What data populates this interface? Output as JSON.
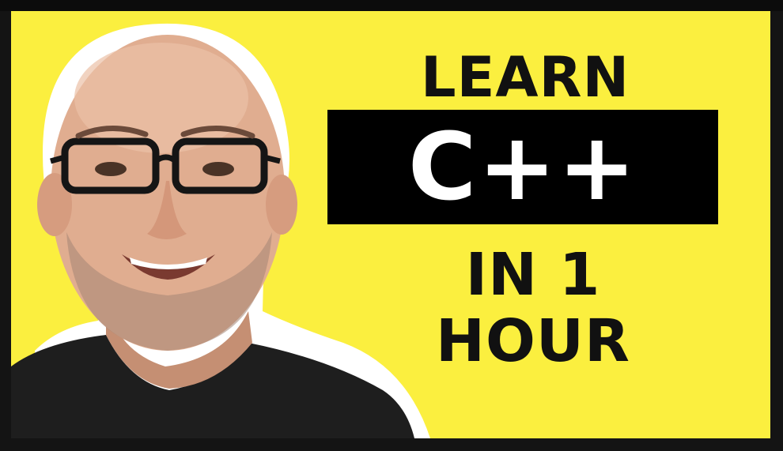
{
  "thumbnail": {
    "line1": "LEARN",
    "line2": "C++",
    "line3": "IN 1 HOUR",
    "colors": {
      "background": "#fbef3f",
      "box": "#000000",
      "box_text": "#ffffff",
      "text": "#111111",
      "frame": "#141414"
    },
    "person_icon": "presenter-photo"
  }
}
